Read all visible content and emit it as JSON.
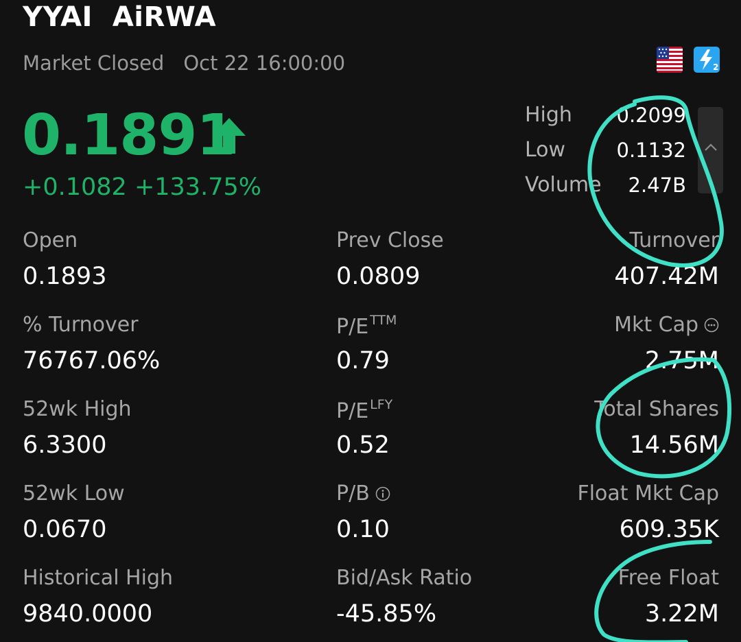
{
  "header": {
    "ticker": "YYAI",
    "name": "AiRWA",
    "market_status": "Market Closed",
    "timestamp": "Oct 22 16:00:00",
    "flag_icon": "us-flag-icon",
    "level_icon": "level2-icon"
  },
  "quote": {
    "price": "0.1891",
    "change": "+0.1082",
    "change_pct": "+133.75%",
    "direction_icon": "arrow-up-icon",
    "up_color": "#1fb36a"
  },
  "summary": {
    "high_label": "High",
    "high_value": "0.2099",
    "low_label": "Low",
    "low_value": "0.1132",
    "volume_label": "Volume",
    "volume_value": "2.47B"
  },
  "stats": {
    "open_label": "Open",
    "open_value": "0.1893",
    "prev_close_label": "Prev Close",
    "prev_close_value": "0.0809",
    "turnover_label": "Turnover",
    "turnover_value": "407.42M",
    "pct_turnover_label": "% Turnover",
    "pct_turnover_value": "76767.06%",
    "pe_ttm_label": "P/E",
    "pe_ttm_sup": "TTM",
    "pe_ttm_value": "0.79",
    "mkt_cap_label": "Mkt Cap",
    "mkt_cap_value": "2.75M",
    "wk52_high_label": "52wk High",
    "wk52_high_value": "6.3300",
    "pe_lfy_label": "P/E",
    "pe_lfy_sup": "LFY",
    "pe_lfy_value": "0.52",
    "total_shares_label": "Total Shares",
    "total_shares_value": "14.56M",
    "wk52_low_label": "52wk Low",
    "wk52_low_value": "0.0670",
    "pb_label": "P/B",
    "pb_value": "0.10",
    "float_mkt_cap_label": "Float Mkt Cap",
    "float_mkt_cap_value": "609.35K",
    "hist_high_label": "Historical High",
    "hist_high_value": "9840.0000",
    "bid_ask_label": "Bid/Ask Ratio",
    "bid_ask_value": "-45.85%",
    "free_float_label": "Free Float",
    "free_float_value": "3.22M"
  },
  "annotation_color": "#3fe0c5"
}
